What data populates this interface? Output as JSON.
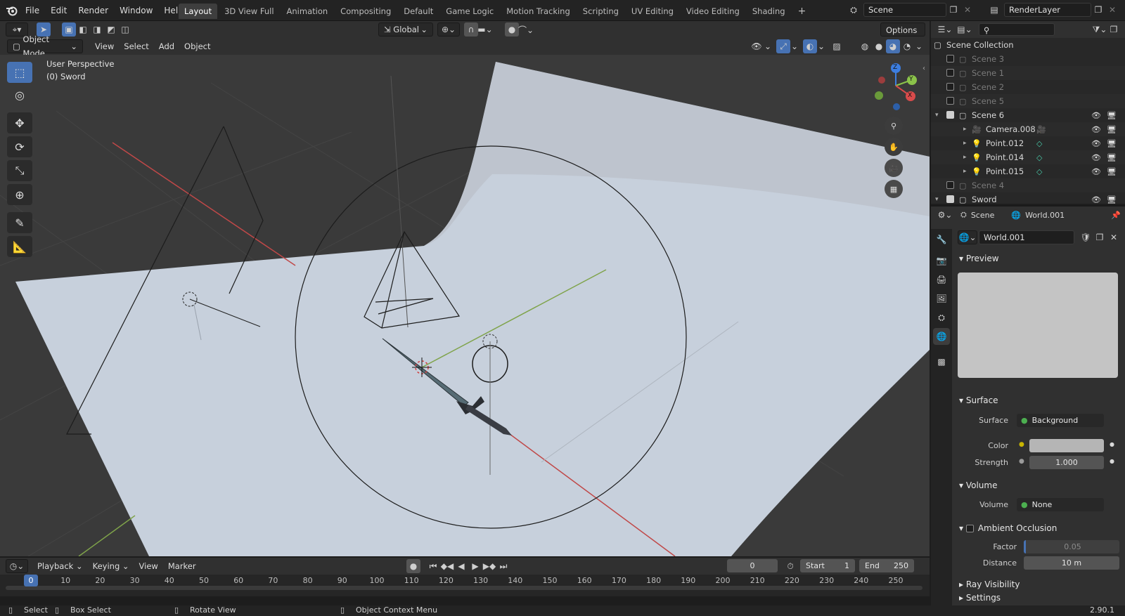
{
  "topbar": {
    "menu": [
      "File",
      "Edit",
      "Render",
      "Window",
      "Help"
    ],
    "tabs": [
      "Layout",
      "3D View Full",
      "Animation",
      "Compositing",
      "Default",
      "Game Logic",
      "Motion Tracking",
      "Scripting",
      "UV Editing",
      "Video Editing",
      "Shading"
    ],
    "active_tab": "Layout",
    "add_tab": "+",
    "scene_name": "Scene",
    "render_layer": "RenderLayer"
  },
  "viewport_header": {
    "orientation": "Global",
    "options": "Options",
    "mode": "Object Mode",
    "menus": [
      "View",
      "Select",
      "Add",
      "Object"
    ]
  },
  "viewport": {
    "perspective": "User Perspective",
    "active_object": "(0) Sword",
    "gizmo": {
      "z": "Z",
      "y": "Y",
      "x": "X"
    }
  },
  "outliner": {
    "root": "Scene Collection",
    "rows": [
      {
        "label": "Scene 3",
        "checked": false,
        "dim": true,
        "kind": "collection"
      },
      {
        "label": "Scene 1",
        "checked": false,
        "dim": true,
        "kind": "collection"
      },
      {
        "label": "Scene 2",
        "checked": false,
        "dim": true,
        "kind": "collection"
      },
      {
        "label": "Scene 5",
        "checked": false,
        "dim": true,
        "kind": "collection"
      },
      {
        "label": "Scene 6",
        "checked": true,
        "dim": false,
        "kind": "collection",
        "expanded": true
      },
      {
        "label": "Camera.008",
        "checked": null,
        "dim": false,
        "kind": "camera"
      },
      {
        "label": "Point.012",
        "checked": null,
        "dim": false,
        "kind": "light"
      },
      {
        "label": "Point.014",
        "checked": null,
        "dim": false,
        "kind": "light"
      },
      {
        "label": "Point.015",
        "checked": null,
        "dim": false,
        "kind": "light"
      },
      {
        "label": "Scene 4",
        "checked": false,
        "dim": true,
        "kind": "collection"
      },
      {
        "label": "Sword",
        "checked": true,
        "dim": false,
        "kind": "collection",
        "expanded": true
      }
    ]
  },
  "properties": {
    "breadcrumb_scene": "Scene",
    "breadcrumb_world": "World.001",
    "world_name": "World.001",
    "preview": "Preview",
    "surface_panel": "Surface",
    "surface_label": "Surface",
    "surface_value": "Background",
    "color_label": "Color",
    "strength_label": "Strength",
    "strength_value": "1.000",
    "volume_panel": "Volume",
    "volume_label": "Volume",
    "volume_value": "None",
    "ao_panel": "Ambient Occlusion",
    "factor_label": "Factor",
    "factor_value": "0.05",
    "distance_label": "Distance",
    "distance_value": "10 m",
    "ray_panel": "Ray Visibility",
    "settings_panel": "Settings"
  },
  "timeline": {
    "menus": [
      "Playback",
      "Keying",
      "View",
      "Marker"
    ],
    "current_frame": "0",
    "start_label": "Start",
    "start_value": "1",
    "end_label": "End",
    "end_value": "250",
    "ticks": [
      "0",
      "10",
      "20",
      "30",
      "40",
      "50",
      "60",
      "70",
      "80",
      "90",
      "100",
      "110",
      "120",
      "130",
      "140",
      "150",
      "160",
      "170",
      "180",
      "190",
      "200",
      "210",
      "220",
      "230",
      "240",
      "250"
    ],
    "playhead_label": "0"
  },
  "statusbar": {
    "select": "Select",
    "box_select": "Box Select",
    "rotate_view": "Rotate View",
    "context_menu": "Object Context Menu",
    "version": "2.90.1"
  },
  "colors": {
    "accent": "#4772b3",
    "x_axis": "#d94b4b",
    "y_axis": "#8bc34a",
    "z_axis": "#3d7ee0",
    "light_icon": "#e07b39",
    "data_icon": "#49c9a8"
  }
}
